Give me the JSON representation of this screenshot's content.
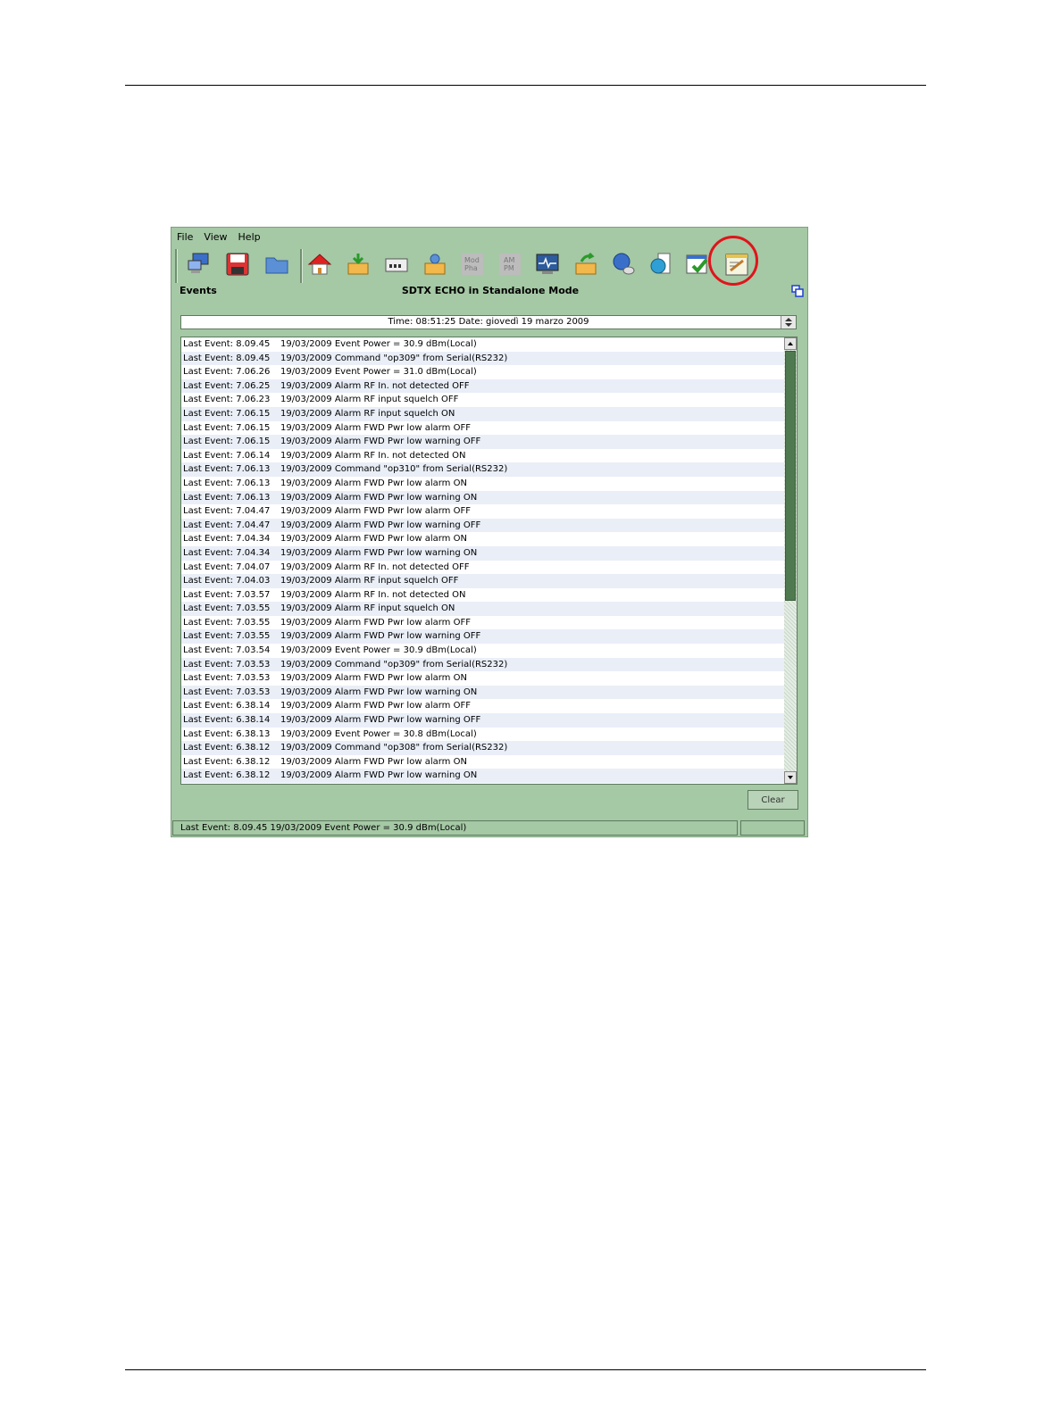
{
  "menu": [
    "File",
    "View",
    "Help"
  ],
  "toolbar_icons": [
    "computer-icon",
    "save-icon",
    "folder-icon",
    "home-icon",
    "download-box-icon",
    "keyboard-icon",
    "settings-box-icon",
    "mod-pha-icon",
    "am-pm-icon",
    "monitor-icon",
    "upload-box-icon",
    "globe-user-icon",
    "globe-doc-icon",
    "checklist-icon",
    "events-notepad-icon"
  ],
  "mod_label_line1": "Mod",
  "mod_label_line2": "Pha",
  "am_label_line1": "AM",
  "am_label_line2": "PM",
  "panel_title": "Events",
  "window_title": "SDTX ECHO in Standalone Mode",
  "time_bar": "Time: 08:51:25   Date: giovedì 19 marzo 2009",
  "events": [
    {
      "time": "Last Event: 8.09.45",
      "text": "19/03/2009 Event Power = 30.9 dBm(Local)"
    },
    {
      "time": "Last Event: 8.09.45",
      "text": "19/03/2009 Command \"op309\" from Serial(RS232)"
    },
    {
      "time": "Last Event: 7.06.26",
      "text": "19/03/2009 Event Power = 31.0 dBm(Local)"
    },
    {
      "time": "Last Event: 7.06.25",
      "text": "19/03/2009 Alarm RF In. not detected OFF"
    },
    {
      "time": "Last Event: 7.06.23",
      "text": "19/03/2009 Alarm RF input squelch OFF"
    },
    {
      "time": "Last Event: 7.06.15",
      "text": "19/03/2009 Alarm RF input squelch ON"
    },
    {
      "time": "Last Event: 7.06.15",
      "text": "19/03/2009 Alarm FWD Pwr low alarm OFF"
    },
    {
      "time": "Last Event: 7.06.15",
      "text": "19/03/2009 Alarm FWD Pwr low warning OFF"
    },
    {
      "time": "Last Event: 7.06.14",
      "text": "19/03/2009 Alarm RF In. not detected ON"
    },
    {
      "time": "Last Event: 7.06.13",
      "text": "19/03/2009 Command \"op310\" from Serial(RS232)"
    },
    {
      "time": "Last Event: 7.06.13",
      "text": "19/03/2009 Alarm FWD Pwr low alarm ON"
    },
    {
      "time": "Last Event: 7.06.13",
      "text": "19/03/2009 Alarm FWD Pwr low warning ON"
    },
    {
      "time": "Last Event: 7.04.47",
      "text": "19/03/2009 Alarm FWD Pwr low alarm OFF"
    },
    {
      "time": "Last Event: 7.04.47",
      "text": "19/03/2009 Alarm FWD Pwr low warning OFF"
    },
    {
      "time": "Last Event: 7.04.34",
      "text": "19/03/2009 Alarm FWD Pwr low alarm ON"
    },
    {
      "time": "Last Event: 7.04.34",
      "text": "19/03/2009 Alarm FWD Pwr low warning ON"
    },
    {
      "time": "Last Event: 7.04.07",
      "text": "19/03/2009 Alarm RF In. not detected OFF"
    },
    {
      "time": "Last Event: 7.04.03",
      "text": "19/03/2009 Alarm RF input squelch OFF"
    },
    {
      "time": "Last Event: 7.03.57",
      "text": "19/03/2009 Alarm RF In. not detected ON"
    },
    {
      "time": "Last Event: 7.03.55",
      "text": "19/03/2009 Alarm RF input squelch ON"
    },
    {
      "time": "Last Event: 7.03.55",
      "text": "19/03/2009 Alarm FWD Pwr low alarm OFF"
    },
    {
      "time": "Last Event: 7.03.55",
      "text": "19/03/2009 Alarm FWD Pwr low warning OFF"
    },
    {
      "time": "Last Event: 7.03.54",
      "text": "19/03/2009 Event Power = 30.9 dBm(Local)"
    },
    {
      "time": "Last Event: 7.03.53",
      "text": "19/03/2009 Command \"op309\" from Serial(RS232)"
    },
    {
      "time": "Last Event: 7.03.53",
      "text": "19/03/2009 Alarm FWD Pwr low alarm ON"
    },
    {
      "time": "Last Event: 7.03.53",
      "text": "19/03/2009 Alarm FWD Pwr low warning ON"
    },
    {
      "time": "Last Event: 6.38.14",
      "text": "19/03/2009 Alarm FWD Pwr low alarm OFF"
    },
    {
      "time": "Last Event: 6.38.14",
      "text": "19/03/2009 Alarm FWD Pwr low warning OFF"
    },
    {
      "time": "Last Event: 6.38.13",
      "text": "19/03/2009 Event Power = 30.8 dBm(Local)"
    },
    {
      "time": "Last Event: 6.38.12",
      "text": "19/03/2009 Command \"op308\" from Serial(RS232)"
    },
    {
      "time": "Last Event: 6.38.12",
      "text": "19/03/2009 Alarm FWD Pwr low alarm ON"
    },
    {
      "time": "Last Event: 6.38.12",
      "text": "19/03/2009 Alarm FWD Pwr low warning ON"
    }
  ],
  "clear_label": "Clear",
  "status_bar": "Last Event: 8.09.45    19/03/2009 Event Power = 30.9 dBm(Local)",
  "colors": {
    "panel": "#a5c8a5",
    "highlight": "#e0141b",
    "row_alt": "#e9eef7"
  }
}
